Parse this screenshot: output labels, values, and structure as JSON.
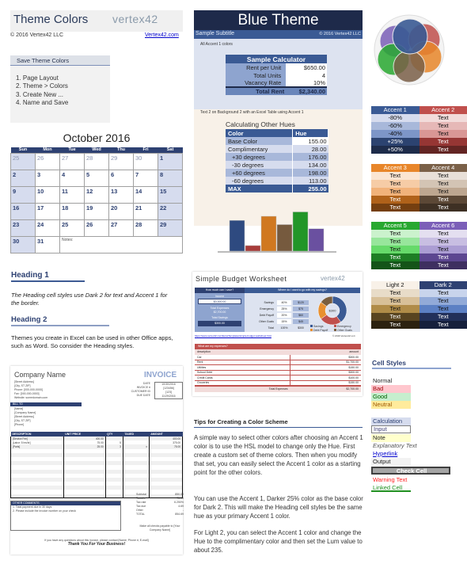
{
  "header": {
    "title": "Theme Colors",
    "logo": "vertex42",
    "copyright": "© 2016 Vertex42 LLC",
    "link": "Vertex42.com"
  },
  "save_box": {
    "title": "Save Theme Colors",
    "steps": [
      "1. Page Layout",
      "2. Theme > Colors",
      "3. Create New ...",
      "4. Name and Save"
    ]
  },
  "calendar": {
    "title": "October 2016",
    "days": [
      "Sun",
      "Mon",
      "Tue",
      "Wed",
      "Thu",
      "Fri",
      "Sat"
    ],
    "weeks": [
      [
        "25",
        "26",
        "27",
        "28",
        "29",
        "30",
        "1"
      ],
      [
        "2",
        "3",
        "4",
        "5",
        "6",
        "7",
        "8"
      ],
      [
        "9",
        "10",
        "11",
        "12",
        "13",
        "14",
        "15"
      ],
      [
        "16",
        "17",
        "18",
        "19",
        "20",
        "21",
        "22"
      ],
      [
        "23",
        "24",
        "25",
        "26",
        "27",
        "28",
        "29"
      ],
      [
        "30",
        "31"
      ]
    ],
    "notes_label": "Notes:"
  },
  "headings": {
    "h1": "Heading 1",
    "h1_text": "The Heading cell styles use Dark 2 for text and Accent 1 for the border.",
    "h2": "Heading 2",
    "h2_text": "Themes you create in Excel can be used in other Office apps, such as Word. So consider the Heading styles."
  },
  "invoice": {
    "company": "Company Name",
    "title": "INVOICE",
    "address_lines": [
      "[Street Address]",
      "[City, ST ZIP]",
      "Phone: [000-000-0000]",
      "Fax: [000-000-0000]",
      "Website: somedomain.com"
    ],
    "meta_labels": [
      "DATE",
      "INVOICE #",
      "CUSTOMER ID",
      "DUE DATE"
    ],
    "meta_values": [
      "10/30/2016",
      "[123456]",
      "[123]",
      "11/29/2016"
    ],
    "bill_to": "BILL TO",
    "bill_lines": [
      "[Name]",
      "[Company Name]",
      "[Street Address]",
      "[City, ST ZIP]",
      "[Phone]"
    ],
    "columns": [
      "DESCRIPTION",
      "UNIT PRICE",
      "QTY",
      "TAXED",
      "AMOUNT"
    ],
    "rows": [
      [
        "[Service Fee]",
        "400.00",
        "",
        "",
        "400.00"
      ],
      [
        "[Labor: 5 hrs/hr]",
        "75.00",
        "5",
        "",
        "375.00"
      ],
      [
        "[Parts]",
        "25.00",
        "3",
        "x",
        "75.00"
      ]
    ],
    "comments_title": "OTHER COMMENTS",
    "comments": [
      "1. Total payment due in 30 days",
      "2. Please include the invoice number on your check"
    ],
    "totals_labels": [
      "Subtotal",
      "Taxable",
      "Tax rate",
      "Tax due",
      "Other",
      "TOTAL"
    ],
    "totals_values": [
      "850.00",
      "75.00",
      "6.250%",
      "4.69",
      "-",
      "854.69"
    ],
    "payable": "Make all checks payable to [Your Company Name]",
    "questions": "If you have any questions about this invoice, please contact [Name, Phone #, E-mail]",
    "thanks": "Thank You For Your Business!"
  },
  "blue_theme": {
    "title": "Blue Theme",
    "subtitle": "Sample Subtitle",
    "copyright": "© 2016 Vertex42 LLC",
    "accent_note": "All Accent 1 colors",
    "calculator": {
      "title": "Sample Calculator",
      "rows": [
        {
          "label": "Rent per Unit",
          "value": "$650.00"
        },
        {
          "label": "Total Units",
          "value": "4"
        },
        {
          "label": "Vacancy Rate",
          "value": "10%"
        }
      ],
      "total_label": "Total Rent",
      "total_value": "$2,340.00"
    },
    "text2_note": "Text 2 on Background 2 with an Excel Table using Accent 1",
    "hues": {
      "title": "Calculating Other Hues",
      "columns": [
        "Color",
        "Hue"
      ],
      "rows": [
        {
          "label": "Base Color",
          "value": "155.00"
        },
        {
          "label": "Complimentary",
          "value": "28.00"
        },
        {
          "label": "+30 degrees",
          "value": "176.00"
        },
        {
          "label": "-30 degrees",
          "value": "134.00"
        },
        {
          "label": "+60 degrees",
          "value": "198.00"
        },
        {
          "label": "-60 degrees",
          "value": "113.00"
        }
      ],
      "max_label": "MAX",
      "max_value": "255.00"
    }
  },
  "chart_data": {
    "type": "bar",
    "categories": [
      "Accent 1",
      "Accent 2",
      "Accent 3",
      "Accent 4",
      "Accent 5",
      "Accent 6"
    ],
    "values": [
      155,
      28,
      176,
      134,
      198,
      113
    ],
    "colors": [
      "#2e4a80",
      "#a83c3a",
      "#d07820",
      "#765a3e",
      "#229628",
      "#6a50a0"
    ],
    "title": "",
    "xlabel": "",
    "ylabel": "",
    "ylim": [
      0,
      200
    ],
    "grid": false
  },
  "budget": {
    "title": "Simple Budget Worksheet",
    "logo": "vertex42",
    "left_header": "How much can I save?",
    "income_label": "Income",
    "income_value": "$3,000.00",
    "expenses_label": "Total Expenses",
    "expenses_value": "$2,700.00",
    "savings_label": "Total Savings",
    "savings_value": "$300.00",
    "right_header": "Where do I want to go with my savings?",
    "goals": [
      {
        "label": "Savings",
        "pct": "40%",
        "amt": "$120"
      },
      {
        "label": "Emergency",
        "pct": "25%",
        "amt": "$75"
      },
      {
        "label": "Debt Payoff",
        "pct": "20%",
        "amt": "$60"
      },
      {
        "label": "Other Goals",
        "pct": "15%",
        "amt": "$45"
      }
    ],
    "total_label": "Total",
    "total_pct": "100%",
    "total_amt": "$300",
    "donut_center": "$300",
    "donut": [
      {
        "label": "Savings",
        "value": 40,
        "color": "#3a5a94"
      },
      {
        "label": "Emergency",
        "value": 25,
        "color": "#c0504d"
      },
      {
        "label": "Debt Payoff",
        "value": 20,
        "color": "#e89030"
      },
      {
        "label": "Other Goals",
        "value": 15,
        "color": "#7a5e3e"
      }
    ],
    "link": "https://www.vertex42.com/ExcelTemplates/simple-budget-worksheet.html",
    "link_right": "© 2016 Vertex42 LLC",
    "expenses_header": "What are my expenses?",
    "exp_columns": [
      "description",
      "amount"
    ],
    "expenses": [
      {
        "label": "Car",
        "value": "$300.00"
      },
      {
        "label": "Rent",
        "value": "$1,700.00"
      },
      {
        "label": "Utilities",
        "value": "$150.00"
      },
      {
        "label": "School Debt",
        "value": "$300.00"
      },
      {
        "label": "Credit Cards",
        "value": "$100.00"
      },
      {
        "label": "Groceries",
        "value": "$150.00"
      }
    ],
    "exp_total_label": "Total Expenses",
    "exp_total_value": "$2,700.00"
  },
  "tips": {
    "title": "Tips for Creating a Color Scheme",
    "p1": "A simple way to select other colors after choosing an Accent 1 color is to use the HSL model to change only the Hue. First create a custom set of theme colors. Then when you modify that set, you can easily select the Accent 1 color as a starting point for the other colors.",
    "p2": "You can use the Accent 1, Darker 25% color as the base color for Dark 2. This will make the Heading cell styles be the same hue as your primary Accent 1 color.",
    "p3": "For Light 2, you can select the Accent 1 color and change the Hue to the complimentary color and then set the Lum value to about 235."
  },
  "accents": [
    {
      "left": "Accent 1",
      "right": "Accent 2",
      "left_cells": [
        "-80%",
        "-60%",
        "-40%",
        "+25%",
        "+50%"
      ],
      "right_cells": [
        "Text",
        "Text",
        "Text",
        "Text",
        "Text"
      ],
      "left_colors": [
        "#3a5a94",
        "#d6dcee",
        "#a8b8da",
        "#7d96c8",
        "#2c4370",
        "#1e2c4a"
      ],
      "right_colors": [
        "#c0504d",
        "#f2dcdb",
        "#e6b8b7",
        "#d99795",
        "#963634",
        "#632523"
      ]
    },
    {
      "left": "Accent 3",
      "right": "Accent 4",
      "left_cells": [
        "Text",
        "Text",
        "Text",
        "Text",
        "Text"
      ],
      "right_cells": [
        "Text",
        "Text",
        "Text",
        "Text",
        "Text"
      ],
      "left_colors": [
        "#e8862a",
        "#fbe5d2",
        "#f6cca6",
        "#f1b27a",
        "#b0621a",
        "#753f10"
      ],
      "right_colors": [
        "#7a6048",
        "#e8e0d8",
        "#d3c4b4",
        "#bda690",
        "#5c4836",
        "#3e3024"
      ]
    },
    {
      "left": "Accent 5",
      "right": "Accent 6",
      "left_cells": [
        "Text",
        "Text",
        "Text",
        "Text",
        "Text"
      ],
      "right_cells": [
        "Text",
        "Text",
        "Text",
        "Text",
        "Text"
      ],
      "left_colors": [
        "#28a830",
        "#cbf2cd",
        "#98e69c",
        "#66da6a",
        "#1e7e24",
        "#145418"
      ],
      "right_colors": [
        "#7b5fb8",
        "#e4dff0",
        "#c8bee2",
        "#ab9dd3",
        "#5c4690",
        "#3e2f60"
      ]
    },
    {
      "left": "Light 2",
      "right": "Dark 2",
      "left_cells": [
        "Text",
        "Text",
        "Text",
        "Text",
        "Text"
      ],
      "right_cells": [
        "Text",
        "Text",
        "Text",
        "Text",
        "Text"
      ],
      "left_colors": [
        "#f8f1e8",
        "#e8dcc8",
        "#d8c098",
        "#b08c48",
        "#584420",
        "#2c2210"
      ],
      "right_colors": [
        "#2e4172",
        "#c8d4ec",
        "#92aad8",
        "#5c80c4",
        "#22305a",
        "#16203c"
      ]
    }
  ],
  "cell_styles": {
    "title": "Cell Styles",
    "items": [
      {
        "label": "Normal"
      },
      {
        "label": "Bad"
      },
      {
        "label": "Good"
      },
      {
        "label": "Neutral"
      },
      {
        "label": "Calculation"
      },
      {
        "label": "Input"
      },
      {
        "label": "Note"
      },
      {
        "label": "Explanatory Text"
      },
      {
        "label": "Hyperlink"
      },
      {
        "label": "Output"
      },
      {
        "label": "Check Cell"
      },
      {
        "label": "Warning Text"
      },
      {
        "label": "Linked Cell"
      }
    ]
  }
}
